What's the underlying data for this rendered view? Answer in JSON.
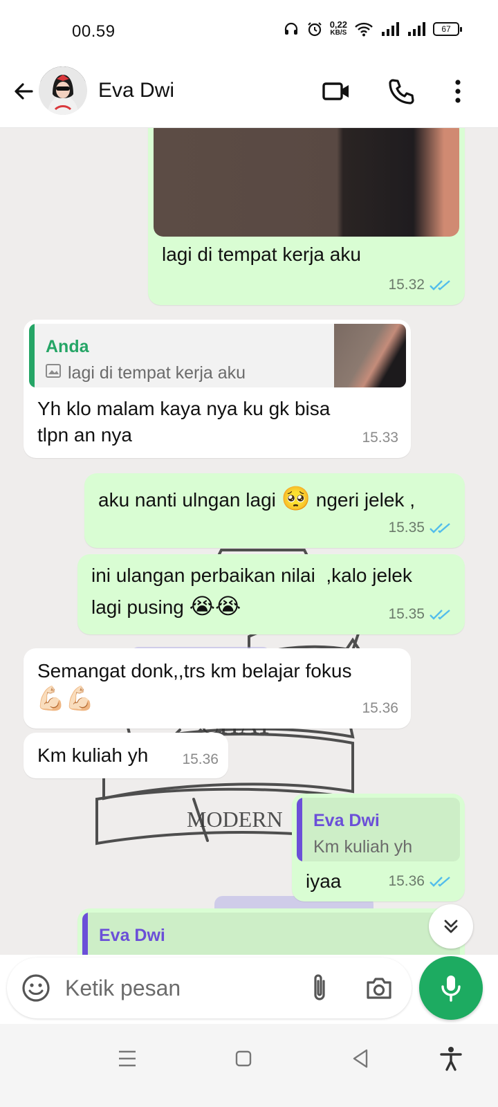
{
  "status_bar": {
    "time": "00.59",
    "net_speed_value": "0,22",
    "net_speed_unit": "KB/S",
    "battery": "67"
  },
  "header": {
    "contact_name": "Eva Dwi"
  },
  "messages": [
    {
      "caption": "lagi di tempat kerja aku",
      "time": "15.32"
    },
    {
      "reply_author": "Anda",
      "reply_text": "lagi di tempat kerja aku",
      "text_line1": "Yh klo malam kaya nya ku gk bisa",
      "text_line2": "tlpn an nya",
      "time": "15.33"
    },
    {
      "text_before_emoji": "aku nanti ulngan lagi",
      "emoji": "🥺",
      "text_after_emoji": "ngeri jelek ,",
      "time": "15.35"
    },
    {
      "text_line1": "ini ulangan perbaikan nilai  ,kalo jelek",
      "text_line2": "lagi pusing",
      "emoji": "😭😭",
      "time": "15.35"
    },
    {
      "text_line1": "Semangat donk,,trs km belajar fokus",
      "emoji": "💪🏻💪🏻",
      "time": "15.36"
    },
    {
      "text": "Km kuliah yh",
      "time": "15.36"
    },
    {
      "reply_author": "Eva Dwi",
      "reply_text": "Km kuliah yh",
      "text": "iyaa",
      "time": "15.36"
    },
    {
      "reply_author": "Eva Dwi"
    }
  ],
  "input": {
    "placeholder": "Ketik pesan"
  },
  "colors": {
    "accent": "#1dab61",
    "outgoing_bubble": "#d9fdd3",
    "incoming_bubble": "#ffffff",
    "read_ticks": "#53bdeb",
    "reply_you": "#25a566",
    "reply_contact": "#6b4fd8"
  }
}
